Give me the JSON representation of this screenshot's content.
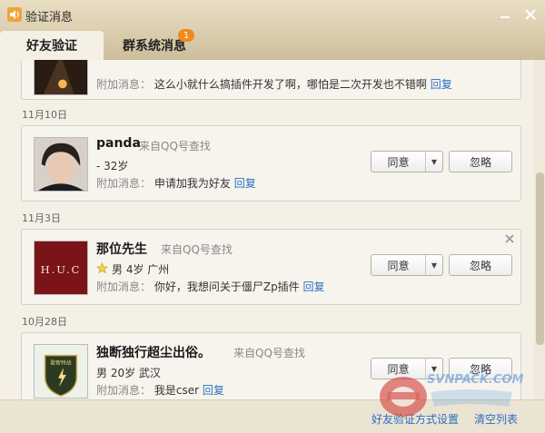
{
  "window": {
    "title": "验证消息"
  },
  "tabs": [
    {
      "label": "好友验证",
      "active": true
    },
    {
      "label": "群系统消息",
      "badge": "1"
    }
  ],
  "labels": {
    "extra": "附加消息：",
    "reply": "回复",
    "agree": "同意",
    "ignore": "忽略"
  },
  "requests": [
    {
      "date": "",
      "name": "",
      "source": "",
      "info": "",
      "message": "这么小就什么搞插件开发了啊，哪怕是二次开发也不错啊"
    },
    {
      "date": "11月10日",
      "name": "panda",
      "source": "来自QQ号查找",
      "info": "-  32岁",
      "message": "申请加我为好友"
    },
    {
      "date": "11月3日",
      "name": "那位先生",
      "source": "来自QQ号查找",
      "info": "男 4岁 广州",
      "message": "你好，我想问关于僵尸Zp插件",
      "avatar_text": "H.U.C"
    },
    {
      "date": "10月28日",
      "name": "独断独行超尘出俗。",
      "source": "来自QQ号查找",
      "info": "男 20岁 武汉",
      "message": "我是cser",
      "avatar_text": "歌智特战"
    }
  ],
  "footer": {
    "settings": "好友验证方式设置",
    "clear": "清空列表"
  },
  "watermark": {
    "text": "SVNPACK.COM"
  }
}
